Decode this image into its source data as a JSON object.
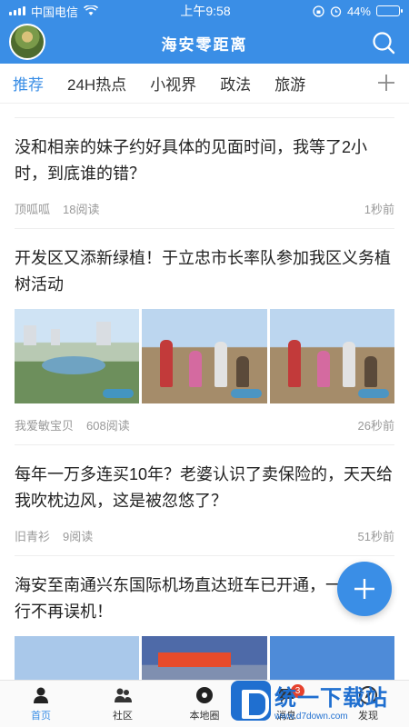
{
  "status_bar": {
    "carrier": "中国电信",
    "time": "上午9:58",
    "battery": "44%",
    "battery_level": 0.44
  },
  "header": {
    "app_title": "海安零距离",
    "avatar_icon": "user-avatar-icon",
    "search_icon": "search-icon"
  },
  "tabs": [
    {
      "label": "推荐",
      "active": true
    },
    {
      "label": "24H热点"
    },
    {
      "label": "小视界"
    },
    {
      "label": "政法"
    },
    {
      "label": "旅游"
    }
  ],
  "articles": [
    {
      "title": "没和相亲的妹子约好具体的见面时间，我等了2小时，到底谁的错？",
      "author": "顶呱呱",
      "reads": "18阅读",
      "time": "1秒前"
    },
    {
      "title": "开发区又添新绿植！于立忠市长率队参加我区义务植树活动",
      "author": "我爱敏宝贝",
      "reads": "608阅读",
      "time": "26秒前"
    },
    {
      "title": "每年一万多连买10年？老婆认识了卖保险的，天天给我吹枕边风，这是被忽悠了？",
      "author": "旧青衫",
      "reads": "9阅读",
      "time": "51秒前"
    },
    {
      "title": "海安至南通兴东国际机场直达班车已开通，一步出行不再误机！"
    }
  ],
  "bottom_nav": [
    {
      "label": "首页",
      "icon": "home-person-icon",
      "active": true
    },
    {
      "label": "社区",
      "icon": "community-icon"
    },
    {
      "label": "本地圈",
      "icon": "local-circle-icon"
    },
    {
      "label": "消息",
      "icon": "message-icon",
      "badge": "3"
    },
    {
      "label": "发现",
      "icon": "discover-icon"
    }
  ],
  "watermark": {
    "name": "统一下载站",
    "url": "www.d7down.com"
  },
  "colors": {
    "brand_blue": "#3a8ee6",
    "text": "#222222",
    "meta": "#999999"
  }
}
